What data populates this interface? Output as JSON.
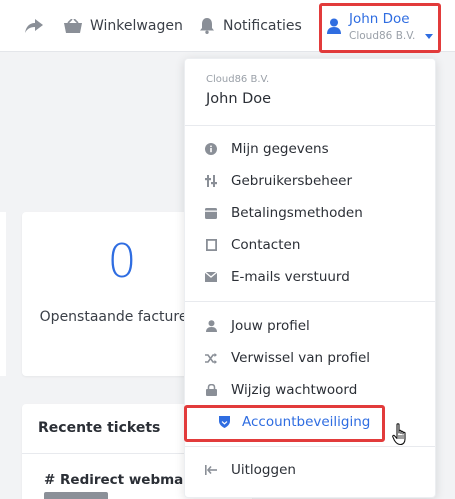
{
  "topbar": {
    "cart_label": "Winkelwagen",
    "notifications_label": "Notificaties",
    "user_name": "John Doe",
    "user_company": "Cloud86 B.V."
  },
  "dashboard": {
    "open_invoices_count": "0",
    "open_invoices_label": "Openstaande facturen",
    "tickets_title": "Recente tickets",
    "ticket_first": "# Redirect webmail n"
  },
  "dropdown": {
    "company": "Cloud86 B.V.",
    "name": "John Doe",
    "account_items": [
      {
        "label": "Mijn gegevens",
        "icon": "info-icon"
      },
      {
        "label": "Gebruikersbeheer",
        "icon": "sliders-icon"
      },
      {
        "label": "Betalingsmethoden",
        "icon": "wallet-icon"
      },
      {
        "label": "Contacten",
        "icon": "contact-icon"
      },
      {
        "label": "E-mails verstuurd",
        "icon": "envelope-icon"
      }
    ],
    "profile_items": [
      {
        "label": "Jouw profiel",
        "icon": "user-icon"
      },
      {
        "label": "Verwissel van profiel",
        "icon": "shuffle-icon"
      },
      {
        "label": "Wijzig wachtwoord",
        "icon": "lock-icon"
      },
      {
        "label": "Accountbeveiliging",
        "icon": "shield-icon"
      }
    ],
    "logout_label": "Uitloggen"
  },
  "colors": {
    "accent": "#2f6de1",
    "highlight": "#e23b3b"
  }
}
